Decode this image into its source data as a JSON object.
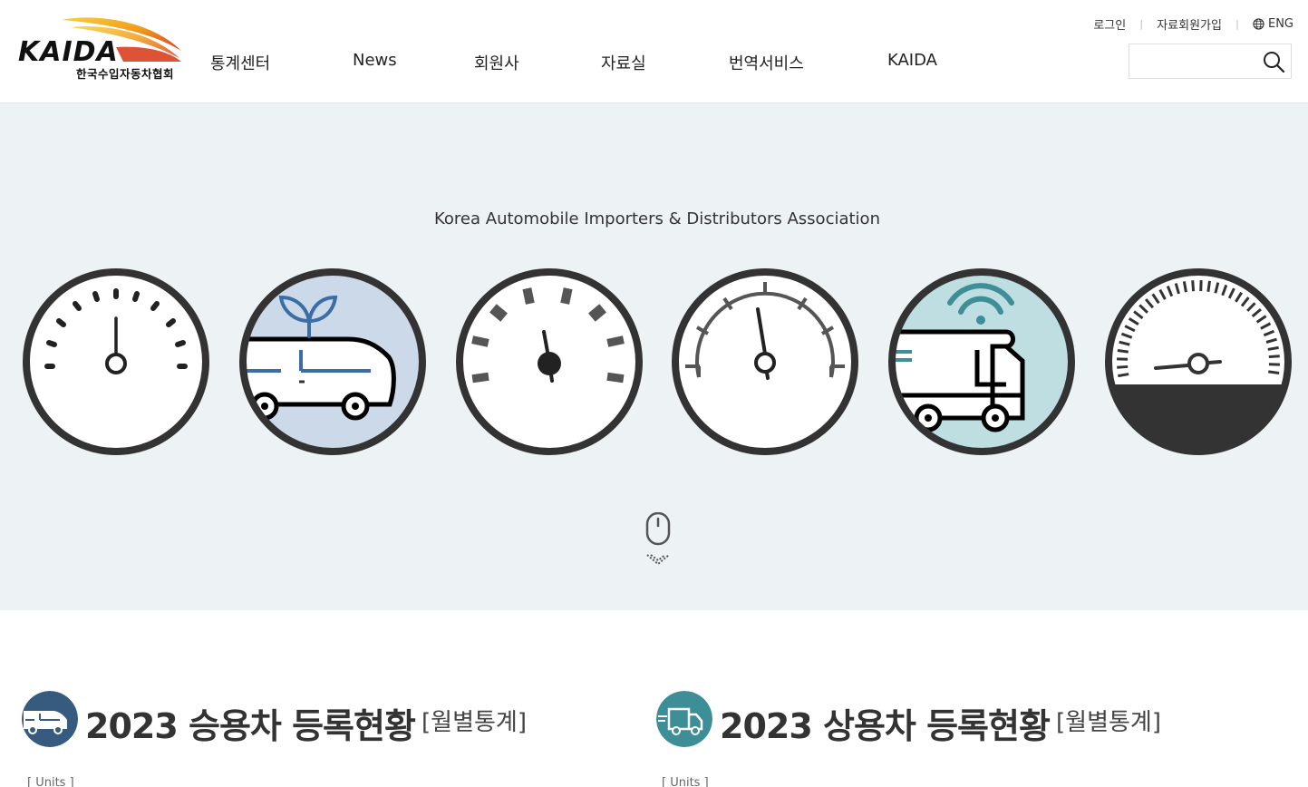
{
  "brand": {
    "logo_text": "KAIDA",
    "logo_subtitle": "한국수입자동차협회"
  },
  "gnb": [
    {
      "label": "통계센터"
    },
    {
      "label": "News"
    },
    {
      "label": "회원사"
    },
    {
      "label": "자료실"
    },
    {
      "label": "번역서비스"
    },
    {
      "label": "KAIDA"
    }
  ],
  "util": {
    "login": "로그인",
    "signup": "자료회원가입",
    "lang": "ENG"
  },
  "search": {
    "placeholder": "",
    "value": ""
  },
  "hero": {
    "tagline": "Korea Automobile Importers & Distributors Association",
    "gauges": [
      {
        "icon": "speedometer-icon"
      },
      {
        "icon": "eco-car-icon"
      },
      {
        "icon": "gauge-dial-icon"
      },
      {
        "icon": "tachometer-icon"
      },
      {
        "icon": "connected-truck-icon"
      },
      {
        "icon": "fuel-gauge-icon"
      }
    ],
    "colors": {
      "bg": "#edf2f5",
      "ring": "#333333",
      "eco": "#ccd9e8",
      "truck": "#bfdee2"
    }
  },
  "sections": {
    "passenger": {
      "title": "2023 승용차 등록현황",
      "sub": "[월별통계]",
      "units": "[ Units ]",
      "icon_color": "#375a7f"
    },
    "commercial": {
      "title": "2023 상용차 등록현황",
      "sub": "[월별통계]",
      "units": "[ Units ]",
      "icon_color": "#3e8e97"
    }
  }
}
